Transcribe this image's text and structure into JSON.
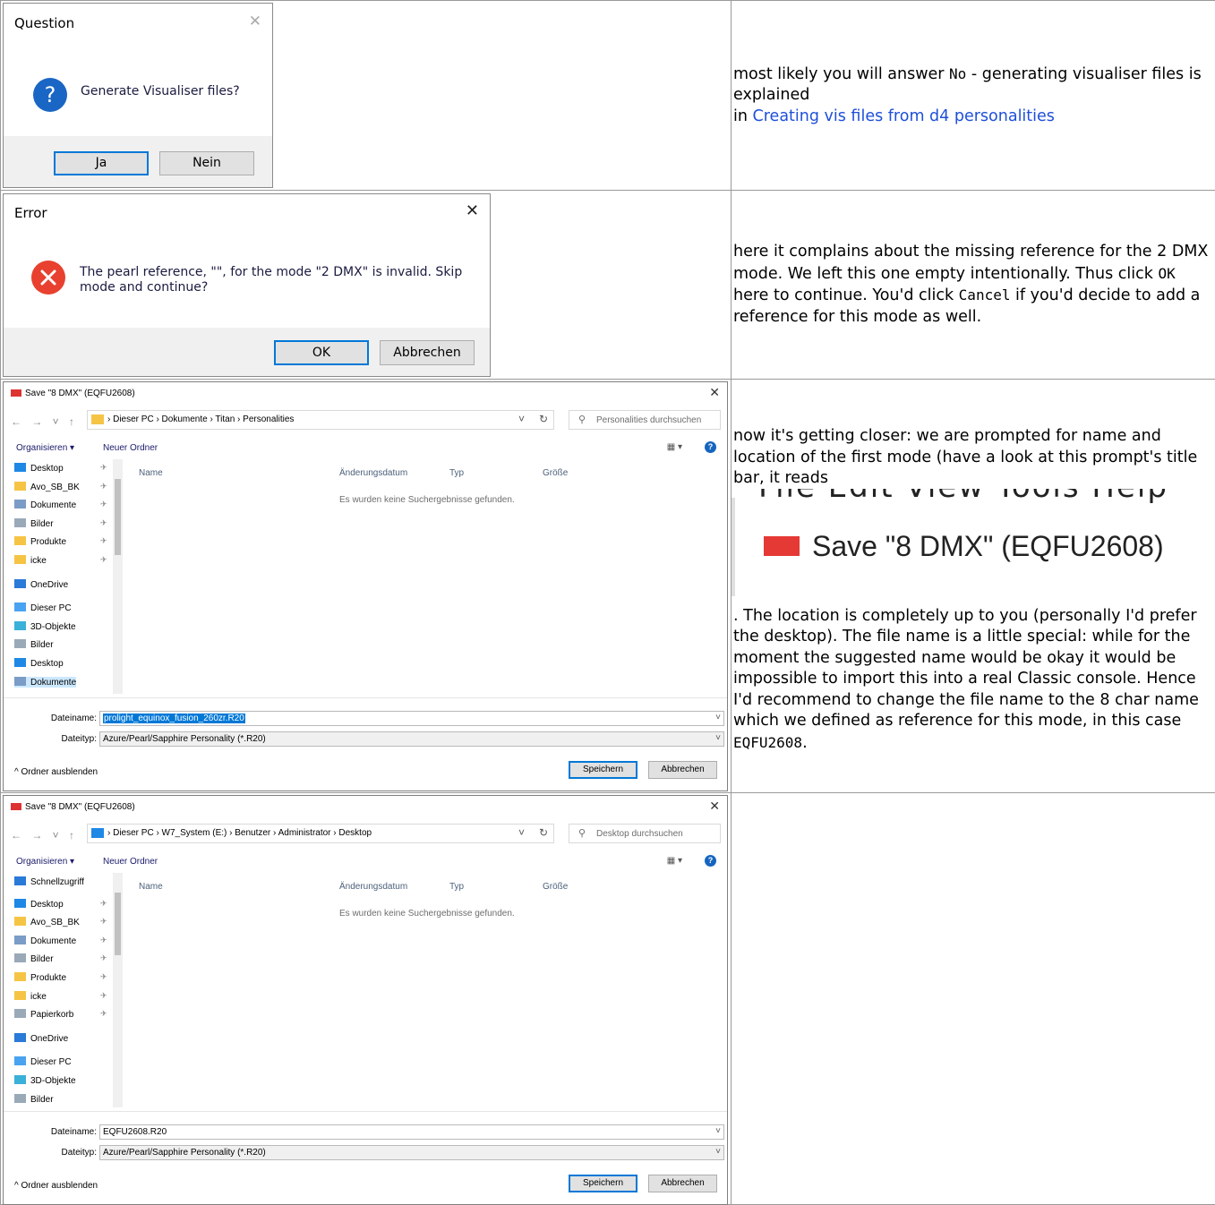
{
  "row1": {
    "dialog": {
      "title": "Question",
      "close_glyph": "✕",
      "message": "Generate Visualiser files?",
      "icon": "question-icon",
      "yes_button": "Ja",
      "no_button": "Nein"
    },
    "text": {
      "before": "most likely you will answer ",
      "code_no": "No",
      "after": " - generating visualiser files is explained",
      "in": "in ",
      "link": "Creating vis files from d4 personalities"
    }
  },
  "row2": {
    "dialog": {
      "title": "Error",
      "close_glyph": "✕",
      "icon": "error-icon",
      "message_line1": "The pearl reference, \"\", for the mode \"2 DMX\" is invalid. Skip",
      "message_line2": "mode and continue?",
      "ok_button": "OK",
      "cancel_button": "Abbrechen"
    },
    "text": {
      "part1": "here it complains about the missing reference for the 2 DMX mode. We left this one empty intentionally. Thus click ",
      "code_ok": "OK",
      "part2": " here to continue. You'd click ",
      "code_cancel": "Cancel",
      "part3": " if you'd decide to add a reference for this mode as well."
    }
  },
  "row3": {
    "dialog": {
      "title": "Save \"8 DMX\" (EQFU2608)",
      "breadcrumb": "›  Dieser PC  ›  Dokumente  ›  Titan  ›  Personalities",
      "search_placeholder": "Personalities durchsuchen",
      "organize": "Organisieren ▾",
      "new_folder": "Neuer Ordner",
      "sidebar": [
        "Desktop",
        "Avo_SB_BK",
        "Dokumente",
        "Bilder",
        "Produkte",
        "icke",
        "OneDrive",
        "Dieser PC",
        "3D-Objekte",
        "Bilder",
        "Desktop",
        "Dokumente"
      ],
      "col_name": "Name",
      "col_date": "Änderungsdatum",
      "col_type": "Typ",
      "col_size": "Größe",
      "empty_text": "Es wurden keine Suchergebnisse gefunden.",
      "filename_label": "Dateiname:",
      "filename_value": "prolight_equinox_fusion_260zr.R20",
      "filetype_label": "Dateityp:",
      "filetype_value": "Azure/Pearl/Sapphire Personality (*.R20)",
      "hide_folders": "^  Ordner ausblenden",
      "save_button": "Speichern",
      "cancel_button": "Abbrechen"
    },
    "text": {
      "part1": "now it's getting closer: we are prompted for name and location of the first mode (have a look at this prompt's title bar, it reads",
      "crop_menu": "File   Edit   View   Tools   Help",
      "crop_title": "Save \"8 DMX\" (EQFU2608)",
      "part2": ". The location is completely up to you (personally I'd prefer the desktop). The file name is a little special: while for the moment the suggested name would be okay it would be impossible to import this into a real Classic console. Hence I'd recommend to change the file name to the 8 char name which we defined as reference for this mode, in this case ",
      "code_name": "EQFU2608",
      "part3": "."
    }
  },
  "row4": {
    "dialog": {
      "title": "Save \"8 DMX\" (EQFU2608)",
      "breadcrumb": "›  Dieser PC  ›  W7_System (E:)  ›  Benutzer  ›  Administrator  ›  Desktop",
      "search_placeholder": "Desktop durchsuchen",
      "organize": "Organisieren ▾",
      "new_folder": "Neuer Ordner",
      "sidebar": [
        "Schnellzugriff",
        "Desktop",
        "Avo_SB_BK",
        "Dokumente",
        "Bilder",
        "Produkte",
        "icke",
        "Papierkorb",
        "OneDrive",
        "Dieser PC",
        "3D-Objekte",
        "Bilder"
      ],
      "col_name": "Name",
      "col_date": "Änderungsdatum",
      "col_type": "Typ",
      "col_size": "Größe",
      "empty_text": "Es wurden keine Suchergebnisse gefunden.",
      "filename_label": "Dateiname:",
      "filename_value": "EQFU2608.R20",
      "filetype_label": "Dateityp:",
      "filetype_value": "Azure/Pearl/Sapphire Personality (*.R20)",
      "hide_folders": "^  Ordner ausblenden",
      "save_button": "Speichern",
      "cancel_button": "Abbrechen"
    }
  },
  "colors": {
    "link": "#1e4fd8",
    "default_button_border": "#0078d7",
    "question_icon": "#1a66c5",
    "error_icon": "#e8412f",
    "selection": "#0078d7"
  }
}
